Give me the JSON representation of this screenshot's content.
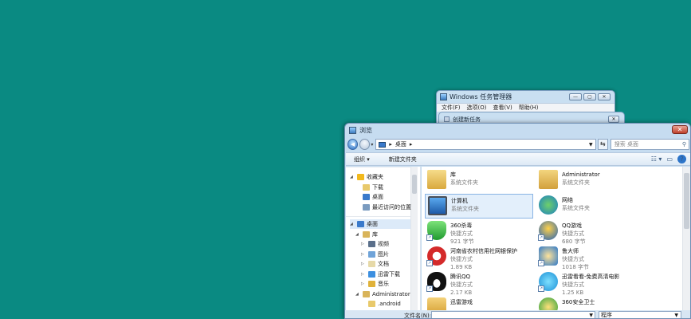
{
  "task_manager": {
    "title": "Windows 任务管理器",
    "menu": [
      "文件(F)",
      "选项(O)",
      "查看(V)",
      "帮助(H)"
    ],
    "controls": [
      "—",
      "▢",
      "✕"
    ]
  },
  "new_task": {
    "title": "创建新任务",
    "close": "✕"
  },
  "browse": {
    "title": "浏览",
    "close": "✕",
    "path": "桌面",
    "search_placeholder": "搜索 桌面",
    "toolbar": {
      "organize": "组织 ▾",
      "new_folder": "新建文件夹"
    },
    "nav": [
      {
        "label": "收藏夹",
        "level": 0,
        "tri": "◢",
        "icon": "star-icon",
        "color": "#f2b91d"
      },
      {
        "label": "下载",
        "level": 1,
        "tri": "",
        "icon": "downloads-icon",
        "color": "#e8c96b"
      },
      {
        "label": "桌面",
        "level": 1,
        "tri": "",
        "icon": "desktop-icon",
        "color": "#3a7acb"
      },
      {
        "label": "最近访问的位置",
        "level": 1,
        "tri": "",
        "icon": "recent-icon",
        "color": "#7a9bbf"
      },
      {
        "label": "桌面",
        "level": 0,
        "tri": "◢",
        "icon": "desktop-icon",
        "color": "#3a7acb",
        "selected": true
      },
      {
        "label": "库",
        "level": 1,
        "tri": "◢",
        "icon": "library-icon",
        "color": "#d9b45a"
      },
      {
        "label": "视频",
        "level": 2,
        "tri": "▷",
        "icon": "video-icon",
        "color": "#5a6f8a"
      },
      {
        "label": "图片",
        "level": 2,
        "tri": "▷",
        "icon": "pictures-icon",
        "color": "#6fa3d8"
      },
      {
        "label": "文档",
        "level": 2,
        "tri": "▷",
        "icon": "documents-icon",
        "color": "#e6d9a8"
      },
      {
        "label": "迅雷下载",
        "level": 2,
        "tri": "▷",
        "icon": "thunder-icon",
        "color": "#3c8fe0"
      },
      {
        "label": "音乐",
        "level": 2,
        "tri": "▷",
        "icon": "music-icon",
        "color": "#e0b23a"
      },
      {
        "label": "Administrator",
        "level": 1,
        "tri": "◢",
        "icon": "user-folder-icon",
        "color": "#d9b45a"
      },
      {
        "label": ".android",
        "level": 2,
        "tri": "",
        "icon": "folder-icon",
        "color": "#e8c96b"
      }
    ],
    "items": [
      {
        "name": "库",
        "sub1": "系统文件夹",
        "sub2": "",
        "icon": "library-icon",
        "shortcut": false
      },
      {
        "name": "Administrator",
        "sub1": "系统文件夹",
        "sub2": "",
        "icon": "user-folder-icon",
        "shortcut": false
      },
      {
        "name": "计算机",
        "sub1": "系统文件夹",
        "sub2": "",
        "icon": "computer-icon",
        "shortcut": false,
        "selected": true
      },
      {
        "name": "网络",
        "sub1": "系统文件夹",
        "sub2": "",
        "icon": "network-icon",
        "shortcut": false
      },
      {
        "name": "360杀毒",
        "sub1": "快捷方式",
        "sub2": "921 字节",
        "icon": "shield-360-icon",
        "shortcut": true
      },
      {
        "name": "QQ游戏",
        "sub1": "快捷方式",
        "sub2": "680 字节",
        "icon": "qq-game-icon",
        "shortcut": true
      },
      {
        "name": "河南省农村信用社网银保护",
        "sub1": "快捷方式",
        "sub2": "1.89 KB",
        "icon": "bank-icon",
        "shortcut": true
      },
      {
        "name": "鲁大师",
        "sub1": "快捷方式",
        "sub2": "1018 字节",
        "icon": "ludashi-icon",
        "shortcut": true
      },
      {
        "name": "腾讯QQ",
        "sub1": "快捷方式",
        "sub2": "2.17 KB",
        "icon": "qq-penguin-icon",
        "shortcut": true
      },
      {
        "name": "迅雷看看-免费高清电影",
        "sub1": "快捷方式",
        "sub2": "1.25 KB",
        "icon": "xunlei-kankan-icon",
        "shortcut": true
      },
      {
        "name": "迅雷游戏",
        "sub1": "",
        "sub2": "",
        "icon": "xunlei-game-icon",
        "shortcut": false
      },
      {
        "name": "360安全卫士",
        "sub1": "",
        "sub2": "",
        "icon": "360-guard-icon",
        "shortcut": false
      }
    ],
    "filename_label": "文件名(N):",
    "filetype": "程序"
  },
  "colors": {
    "desktop": "#0a8a82",
    "selection": "#e3effb"
  }
}
